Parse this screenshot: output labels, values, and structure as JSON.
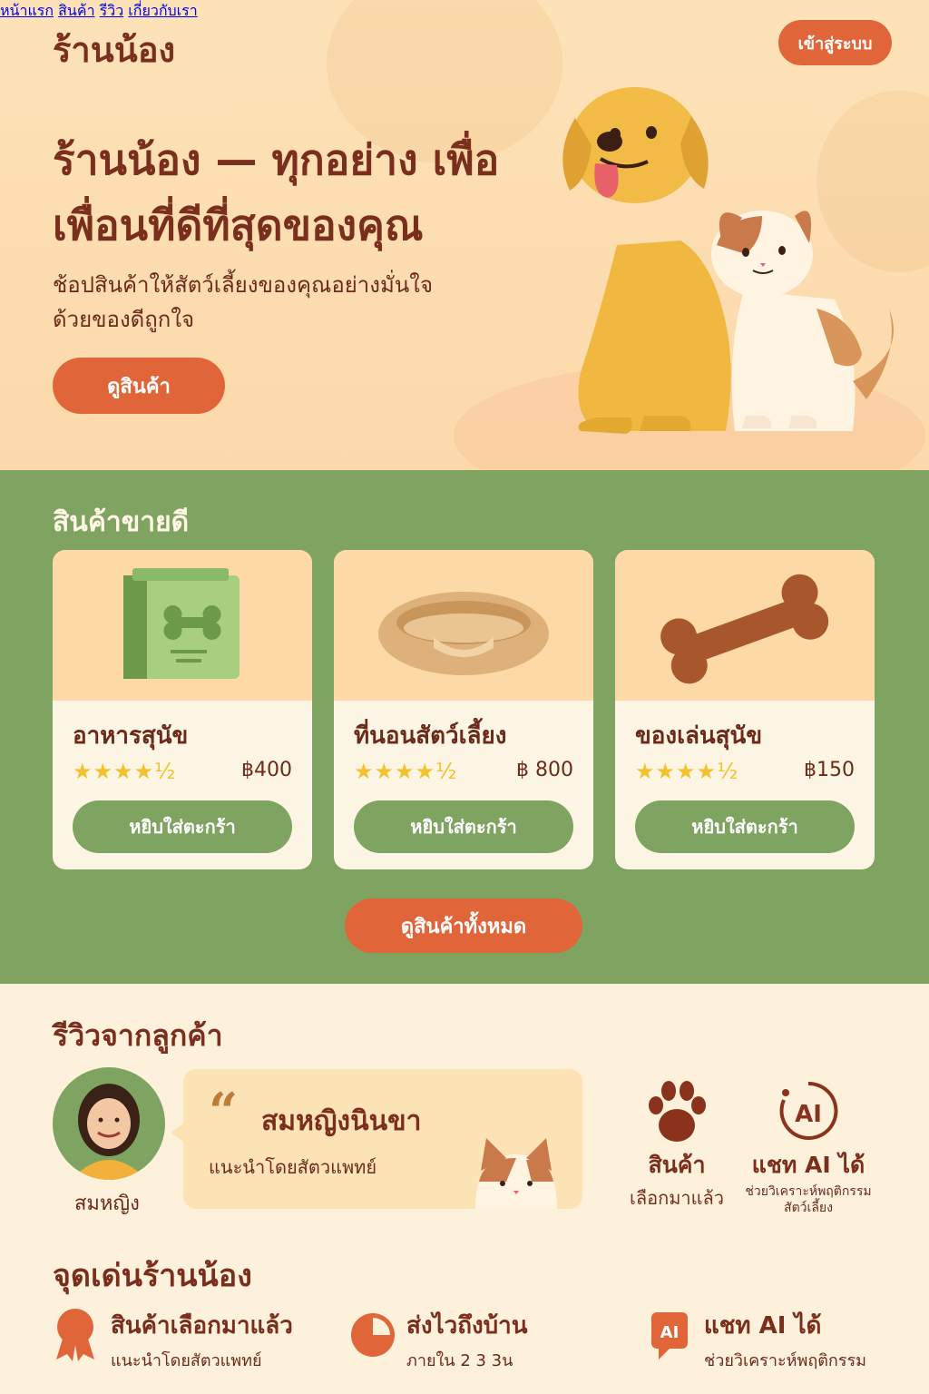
{
  "header": {
    "logo": "ร้านน้อง",
    "nav": [
      "หน้าแรก",
      "สินค้า",
      "รีวิว",
      "เกี่ยวกับเรา"
    ],
    "login_label": "เข้าสู่ระบบ"
  },
  "hero": {
    "title": "ร้านน้อง — ทุกอย่าง เพื่อเพื่อนที่ดีที่สุดของคุณ",
    "subtitle": "ช้อปสินค้าให้สัตว์เลี้ยงของคุณอย่างมั่นใจ ด้วยของดีถูกใจ",
    "cta_label": "ดูสินค้า"
  },
  "best_sellers": {
    "title": "สินค้าขายดี",
    "products": [
      {
        "name": "อาหารสุนัข",
        "rating": 4.5,
        "stars": "★★★★½",
        "price": "฿400",
        "cta": "หยิบใส่ตะกร้า"
      },
      {
        "name": "ที่นอนสัตว์เลี้ยง",
        "rating": 4.5,
        "stars": "★★★★½",
        "price": "฿ 800",
        "cta": "หยิบใส่ตะกร้า"
      },
      {
        "name": "ของเล่นสุนัข",
        "rating": 4.5,
        "stars": "★★★★½",
        "price": "฿150",
        "cta": "หยิบใส่ตะกร้า"
      }
    ],
    "all_label": "ดูสินค้าทั้งหมด"
  },
  "reviews": {
    "title": "รีวิวจากลูกค้า",
    "reviewer_name": "สมหญิง",
    "quote": "สมหญิงนินขา",
    "role": "แนะนำโดยสัตวแพทย์",
    "features": [
      {
        "icon": "paw-icon",
        "label": "สินค้า",
        "sub": "เลือกมาแล้ว"
      },
      {
        "icon": "ai-icon",
        "label": "แชท AI ได้",
        "sub": "ช่วยวิเคราะห์พฤติกรรม สัตว์เลี้ยง"
      }
    ]
  },
  "highlights": {
    "title": "จุดเด่นร้านน้อง",
    "items": [
      {
        "icon": "award-icon",
        "label": "สินค้าเลือกมาแล้ว",
        "sub": "แนะนำโดยสัตวแพทย์"
      },
      {
        "icon": "clock-icon",
        "label": "ส่งไวถึงบ้าน",
        "sub": "ภายใน 2 3 3น"
      },
      {
        "icon": "ai-chat-icon",
        "label": "แชท AI ได้",
        "sub": "ช่วยวิเคราะห์พฤติกรรม"
      }
    ]
  },
  "colors": {
    "hero_bg": "#fde2b8",
    "accent_orange": "#e0663a",
    "green": "#7fa462",
    "brown_text": "#7a2f1c",
    "cream": "#fdf1dc",
    "star": "#f2c12e"
  }
}
